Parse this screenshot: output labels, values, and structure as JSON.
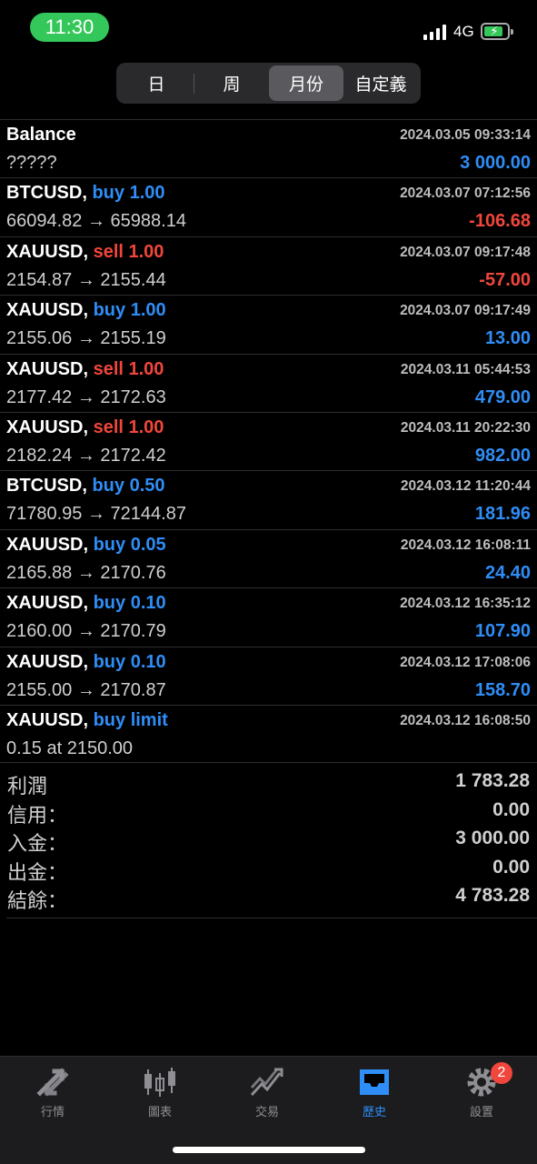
{
  "status": {
    "time": "11:30",
    "network": "4G"
  },
  "periods": [
    "日",
    "周",
    "月份",
    "自定義"
  ],
  "active_period": "月份",
  "rows": [
    {
      "symbol": "Balance",
      "side_text": "",
      "side": "",
      "date": "2024.03.05 09:33:14",
      "detail": "?????",
      "profit": "3 000.00",
      "profit_sign": "pos"
    },
    {
      "symbol": "BTCUSD,",
      "side_text": "buy 1.00",
      "side": "buy",
      "date": "2024.03.07 07:12:56",
      "detail": "66094.82 → 65988.14",
      "profit": "-106.68",
      "profit_sign": "neg"
    },
    {
      "symbol": "XAUUSD,",
      "side_text": "sell 1.00",
      "side": "sell",
      "date": "2024.03.07 09:17:48",
      "detail": "2154.87 → 2155.44",
      "profit": "-57.00",
      "profit_sign": "neg"
    },
    {
      "symbol": "XAUUSD,",
      "side_text": "buy 1.00",
      "side": "buy",
      "date": "2024.03.07 09:17:49",
      "detail": "2155.06 → 2155.19",
      "profit": "13.00",
      "profit_sign": "pos"
    },
    {
      "symbol": "XAUUSD,",
      "side_text": "sell 1.00",
      "side": "sell",
      "date": "2024.03.11 05:44:53",
      "detail": "2177.42 → 2172.63",
      "profit": "479.00",
      "profit_sign": "pos"
    },
    {
      "symbol": "XAUUSD,",
      "side_text": "sell 1.00",
      "side": "sell",
      "date": "2024.03.11 20:22:30",
      "detail": "2182.24 → 2172.42",
      "profit": "982.00",
      "profit_sign": "pos"
    },
    {
      "symbol": "BTCUSD,",
      "side_text": "buy 0.50",
      "side": "buy",
      "date": "2024.03.12 11:20:44",
      "detail": "71780.95 → 72144.87",
      "profit": "181.96",
      "profit_sign": "pos"
    },
    {
      "symbol": "XAUUSD,",
      "side_text": "buy 0.05",
      "side": "buy",
      "date": "2024.03.12 16:08:11",
      "detail": "2165.88 → 2170.76",
      "profit": "24.40",
      "profit_sign": "pos"
    },
    {
      "symbol": "XAUUSD,",
      "side_text": "buy 0.10",
      "side": "buy",
      "date": "2024.03.12 16:35:12",
      "detail": "2160.00 → 2170.79",
      "profit": "107.90",
      "profit_sign": "pos"
    },
    {
      "symbol": "XAUUSD,",
      "side_text": "buy 0.10",
      "side": "buy",
      "date": "2024.03.12 17:08:06",
      "detail": "2155.00 → 2170.87",
      "profit": "158.70",
      "profit_sign": "pos"
    },
    {
      "symbol": "XAUUSD,",
      "side_text": "buy limit",
      "side": "buy",
      "date": "2024.03.12 16:08:50",
      "detail": "0.15 at 2150.00",
      "profit": "",
      "profit_sign": "pos"
    }
  ],
  "summary": [
    {
      "label": "利潤",
      "value": "1 783.28"
    },
    {
      "label": "信用：",
      "value": "0.00"
    },
    {
      "label": "入金：",
      "value": "3 000.00"
    },
    {
      "label": "出金：",
      "value": "0.00"
    },
    {
      "label": "結餘：",
      "value": "4 783.28"
    }
  ],
  "tabs": [
    {
      "label": "行情",
      "icon": "quotes-arrows-icon"
    },
    {
      "label": "圖表",
      "icon": "candlestick-chart-icon"
    },
    {
      "label": "交易",
      "icon": "trade-trend-icon"
    },
    {
      "label": "歷史",
      "icon": "history-inbox-icon"
    },
    {
      "label": "設置",
      "icon": "gear-icon"
    }
  ],
  "active_tab": "歷史",
  "settings_badge": "2",
  "colors": {
    "buy": "#2f8df6",
    "sell": "#f0463c",
    "active_tab": "#2f8df6",
    "status_pill": "#34c759"
  }
}
